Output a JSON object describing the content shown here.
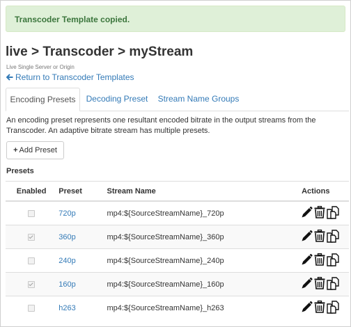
{
  "alert": {
    "message": "Transcoder Template copied."
  },
  "header": {
    "title": "live > Transcoder > myStream",
    "subtitle": "Live Single Server or Origin",
    "back_link": "Return to Transcoder Templates"
  },
  "tabs": [
    {
      "label": "Encoding Presets",
      "active": true
    },
    {
      "label": "Decoding Preset",
      "active": false
    },
    {
      "label": "Stream Name Groups",
      "active": false
    }
  ],
  "description": "An encoding preset represents one resultant encoded bitrate in the output streams from the Transcoder. An adaptive bitrate stream has multiple presets.",
  "add_button": {
    "label": "Add Preset"
  },
  "section_label": "Presets",
  "table": {
    "columns": [
      "Enabled",
      "Preset",
      "Stream Name",
      "Actions"
    ],
    "rows": [
      {
        "enabled": false,
        "preset": "720p",
        "stream_name": "mp4:${SourceStreamName}_720p"
      },
      {
        "enabled": true,
        "preset": "360p",
        "stream_name": "mp4:${SourceStreamName}_360p"
      },
      {
        "enabled": false,
        "preset": "240p",
        "stream_name": "mp4:${SourceStreamName}_240p"
      },
      {
        "enabled": true,
        "preset": "160p",
        "stream_name": "mp4:${SourceStreamName}_160p"
      },
      {
        "enabled": false,
        "preset": "h263",
        "stream_name": "mp4:${SourceStreamName}_h263"
      }
    ]
  },
  "colors": {
    "link": "#337ab7",
    "success_bg": "#dff0d8",
    "success_text": "#3c763d"
  },
  "icons": {
    "back": "arrow-left-icon",
    "add": "plus-icon",
    "edit": "pencil-icon",
    "delete": "trash-icon",
    "copy": "copy-icon"
  }
}
